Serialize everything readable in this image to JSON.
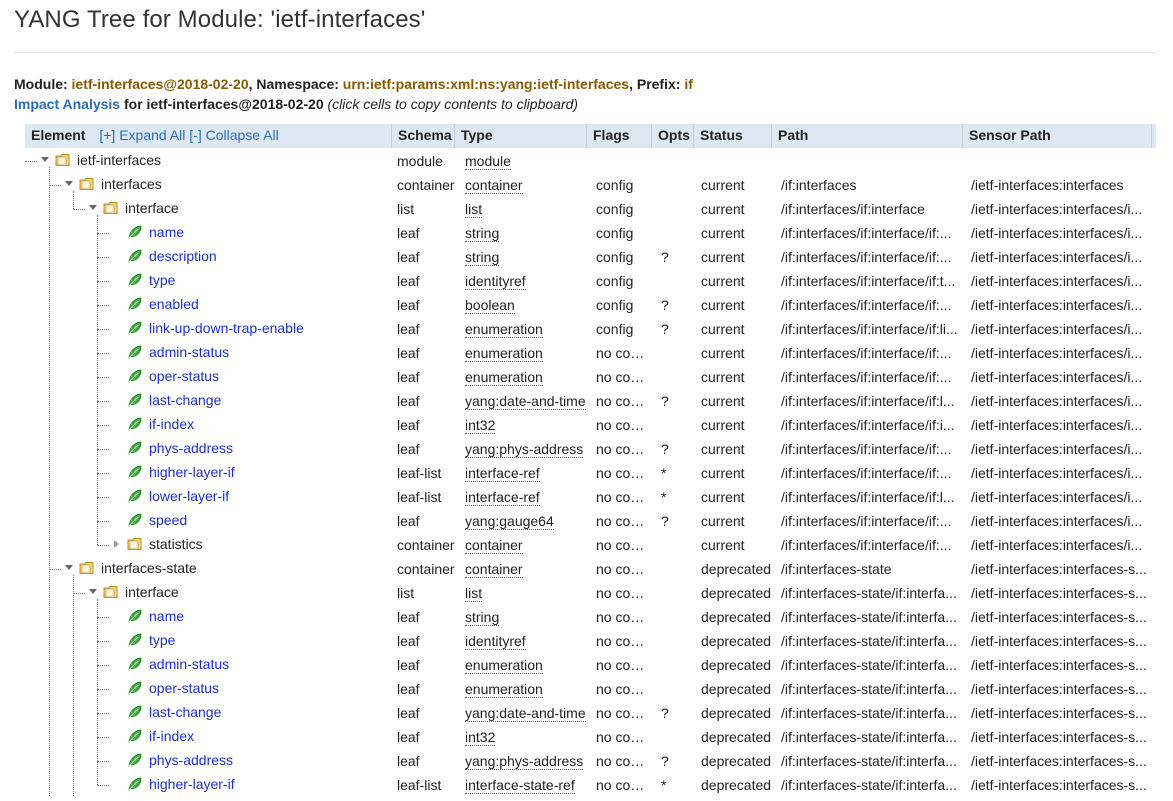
{
  "page": {
    "title": "YANG Tree for Module: 'ietf-interfaces'"
  },
  "meta": {
    "module_label": "Module: ",
    "module_value": "ietf-interfaces@2018-02-20",
    "namespace_label": ", Namespace: ",
    "namespace_value": "urn:ietf:params:xml:ns:yang:ietf-interfaces",
    "prefix_label": ", Prefix: ",
    "prefix_value": "if",
    "impact_link": "Impact Analysis",
    "impact_for": " for ietf-interfaces@2018-02-20",
    "impact_hint": " (click cells to copy contents to clipboard)"
  },
  "table": {
    "headers": {
      "element": "Element",
      "expand_all": "[+] Expand All",
      "collapse_all": "[-] Collapse All",
      "schema": "Schema",
      "type": "Type",
      "flags": "Flags",
      "opts": "Opts",
      "status": "Status",
      "path": "Path",
      "sensor_path": "Sensor Path"
    },
    "rows": [
      {
        "name": "ietf-interfaces",
        "level": 0,
        "icon": "folder-icon",
        "toggle": "open",
        "schema": "module",
        "type": "module",
        "flags": "",
        "opts": "",
        "status": "",
        "path": "",
        "sensor": ""
      },
      {
        "name": "interfaces",
        "level": 1,
        "icon": "folder-icon",
        "toggle": "open",
        "schema": "container",
        "type": "container",
        "flags": "config",
        "opts": "",
        "status": "current",
        "path": "/if:interfaces",
        "sensor": "/ietf-interfaces:interfaces"
      },
      {
        "name": "interface",
        "level": 2,
        "icon": "folder-icon",
        "toggle": "open",
        "schema": "list",
        "type": "list",
        "flags": "config",
        "opts": "",
        "status": "current",
        "path": "/if:interfaces/if:interface",
        "sensor": "/ietf-interfaces:interfaces/i..."
      },
      {
        "name": "name",
        "level": 3,
        "icon": "leaf-icon",
        "toggle": "",
        "schema": "leaf",
        "type": "string",
        "flags": "config",
        "opts": "",
        "status": "current",
        "path": "/if:interfaces/if:interface/if:...",
        "sensor": "/ietf-interfaces:interfaces/i..."
      },
      {
        "name": "description",
        "level": 3,
        "icon": "leaf-icon",
        "toggle": "",
        "schema": "leaf",
        "type": "string",
        "flags": "config",
        "opts": "?",
        "status": "current",
        "path": "/if:interfaces/if:interface/if:...",
        "sensor": "/ietf-interfaces:interfaces/i..."
      },
      {
        "name": "type",
        "level": 3,
        "icon": "leaf-icon",
        "toggle": "",
        "schema": "leaf",
        "type": "identityref",
        "flags": "config",
        "opts": "",
        "status": "current",
        "path": "/if:interfaces/if:interface/if:t...",
        "sensor": "/ietf-interfaces:interfaces/i..."
      },
      {
        "name": "enabled",
        "level": 3,
        "icon": "leaf-icon",
        "toggle": "",
        "schema": "leaf",
        "type": "boolean",
        "flags": "config",
        "opts": "?",
        "status": "current",
        "path": "/if:interfaces/if:interface/if:...",
        "sensor": "/ietf-interfaces:interfaces/i..."
      },
      {
        "name": "link-up-down-trap-enable",
        "level": 3,
        "icon": "leaf-icon",
        "toggle": "",
        "schema": "leaf",
        "type": "enumeration",
        "flags": "config",
        "opts": "?",
        "status": "current",
        "path": "/if:interfaces/if:interface/if:li...",
        "sensor": "/ietf-interfaces:interfaces/i..."
      },
      {
        "name": "admin-status",
        "level": 3,
        "icon": "leaf-icon",
        "toggle": "",
        "schema": "leaf",
        "type": "enumeration",
        "flags": "no config",
        "opts": "",
        "status": "current",
        "path": "/if:interfaces/if:interface/if:...",
        "sensor": "/ietf-interfaces:interfaces/i..."
      },
      {
        "name": "oper-status",
        "level": 3,
        "icon": "leaf-icon",
        "toggle": "",
        "schema": "leaf",
        "type": "enumeration",
        "flags": "no config",
        "opts": "",
        "status": "current",
        "path": "/if:interfaces/if:interface/if:...",
        "sensor": "/ietf-interfaces:interfaces/i..."
      },
      {
        "name": "last-change",
        "level": 3,
        "icon": "leaf-icon",
        "toggle": "",
        "schema": "leaf",
        "type": "yang:date-and-time",
        "flags": "no config",
        "opts": "?",
        "status": "current",
        "path": "/if:interfaces/if:interface/if:l...",
        "sensor": "/ietf-interfaces:interfaces/i..."
      },
      {
        "name": "if-index",
        "level": 3,
        "icon": "leaf-icon",
        "toggle": "",
        "schema": "leaf",
        "type": "int32",
        "flags": "no config",
        "opts": "",
        "status": "current",
        "path": "/if:interfaces/if:interface/if:i...",
        "sensor": "/ietf-interfaces:interfaces/i..."
      },
      {
        "name": "phys-address",
        "level": 3,
        "icon": "leaf-icon",
        "toggle": "",
        "schema": "leaf",
        "type": "yang:phys-address",
        "flags": "no config",
        "opts": "?",
        "status": "current",
        "path": "/if:interfaces/if:interface/if:...",
        "sensor": "/ietf-interfaces:interfaces/i..."
      },
      {
        "name": "higher-layer-if",
        "level": 3,
        "icon": "leaf-icon",
        "toggle": "",
        "schema": "leaf-list",
        "type": "interface-ref",
        "flags": "no config",
        "opts": "*",
        "status": "current",
        "path": "/if:interfaces/if:interface/if:...",
        "sensor": "/ietf-interfaces:interfaces/i..."
      },
      {
        "name": "lower-layer-if",
        "level": 3,
        "icon": "leaf-icon",
        "toggle": "",
        "schema": "leaf-list",
        "type": "interface-ref",
        "flags": "no config",
        "opts": "*",
        "status": "current",
        "path": "/if:interfaces/if:interface/if:l...",
        "sensor": "/ietf-interfaces:interfaces/i..."
      },
      {
        "name": "speed",
        "level": 3,
        "icon": "leaf-icon",
        "toggle": "",
        "schema": "leaf",
        "type": "yang:gauge64",
        "flags": "no config",
        "opts": "?",
        "status": "current",
        "path": "/if:interfaces/if:interface/if:...",
        "sensor": "/ietf-interfaces:interfaces/i..."
      },
      {
        "name": "statistics",
        "level": 3,
        "icon": "folder-icon",
        "toggle": "closed",
        "schema": "container",
        "type": "container",
        "flags": "no config",
        "opts": "",
        "status": "current",
        "path": "/if:interfaces/if:interface/if:...",
        "sensor": "/ietf-interfaces:interfaces/i..."
      },
      {
        "name": "interfaces-state",
        "level": 1,
        "icon": "folder-icon",
        "toggle": "open",
        "schema": "container",
        "type": "container",
        "flags": "no config",
        "opts": "",
        "status": "deprecated",
        "path": "/if:interfaces-state",
        "sensor": "/ietf-interfaces:interfaces-s..."
      },
      {
        "name": "interface",
        "level": 2,
        "icon": "folder-icon",
        "toggle": "open",
        "schema": "list",
        "type": "list",
        "flags": "no config",
        "opts": "",
        "status": "deprecated",
        "path": "/if:interfaces-state/if:interfa...",
        "sensor": "/ietf-interfaces:interfaces-s..."
      },
      {
        "name": "name",
        "level": 3,
        "icon": "leaf-icon",
        "toggle": "",
        "schema": "leaf",
        "type": "string",
        "flags": "no config",
        "opts": "",
        "status": "deprecated",
        "path": "/if:interfaces-state/if:interfa...",
        "sensor": "/ietf-interfaces:interfaces-s..."
      },
      {
        "name": "type",
        "level": 3,
        "icon": "leaf-icon",
        "toggle": "",
        "schema": "leaf",
        "type": "identityref",
        "flags": "no config",
        "opts": "",
        "status": "deprecated",
        "path": "/if:interfaces-state/if:interfa...",
        "sensor": "/ietf-interfaces:interfaces-s..."
      },
      {
        "name": "admin-status",
        "level": 3,
        "icon": "leaf-icon",
        "toggle": "",
        "schema": "leaf",
        "type": "enumeration",
        "flags": "no config",
        "opts": "",
        "status": "deprecated",
        "path": "/if:interfaces-state/if:interfa...",
        "sensor": "/ietf-interfaces:interfaces-s..."
      },
      {
        "name": "oper-status",
        "level": 3,
        "icon": "leaf-icon",
        "toggle": "",
        "schema": "leaf",
        "type": "enumeration",
        "flags": "no config",
        "opts": "",
        "status": "deprecated",
        "path": "/if:interfaces-state/if:interfa...",
        "sensor": "/ietf-interfaces:interfaces-s..."
      },
      {
        "name": "last-change",
        "level": 3,
        "icon": "leaf-icon",
        "toggle": "",
        "schema": "leaf",
        "type": "yang:date-and-time",
        "flags": "no config",
        "opts": "?",
        "status": "deprecated",
        "path": "/if:interfaces-state/if:interfa...",
        "sensor": "/ietf-interfaces:interfaces-s..."
      },
      {
        "name": "if-index",
        "level": 3,
        "icon": "leaf-icon",
        "toggle": "",
        "schema": "leaf",
        "type": "int32",
        "flags": "no config",
        "opts": "",
        "status": "deprecated",
        "path": "/if:interfaces-state/if:interfa...",
        "sensor": "/ietf-interfaces:interfaces-s..."
      },
      {
        "name": "phys-address",
        "level": 3,
        "icon": "leaf-icon",
        "toggle": "",
        "schema": "leaf",
        "type": "yang:phys-address",
        "flags": "no config",
        "opts": "?",
        "status": "deprecated",
        "path": "/if:interfaces-state/if:interfa...",
        "sensor": "/ietf-interfaces:interfaces-s..."
      },
      {
        "name": "higher-layer-if",
        "level": 3,
        "icon": "leaf-icon",
        "toggle": "",
        "schema": "leaf-list",
        "type": "interface-state-ref",
        "flags": "no config",
        "opts": "*",
        "status": "deprecated",
        "path": "/if:interfaces-state/if:interfa...",
        "sensor": "/ietf-interfaces:interfaces-s..."
      }
    ]
  },
  "colors": {
    "header_bg": "#dde8f4",
    "link": "#2a6ebb",
    "leaf_name": "#1d2fd4",
    "meta_value": "#8a5a00"
  }
}
